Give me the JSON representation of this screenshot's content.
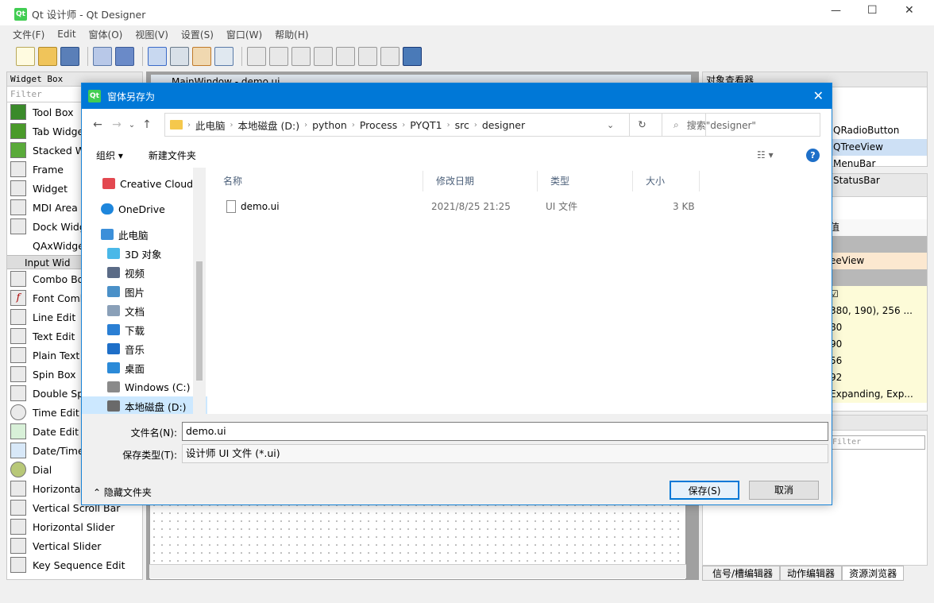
{
  "app": {
    "title": "Qt 设计师 - Qt Designer",
    "logo": "Qt"
  },
  "menu": [
    "文件(F)",
    "Edit",
    "窗体(O)",
    "视图(V)",
    "设置(S)",
    "窗口(W)",
    "帮助(H)"
  ],
  "window_controls": {
    "minimize": "—",
    "maximize": "☐",
    "close": "✕"
  },
  "widget_box": {
    "title": "Widget Box",
    "filter_placeholder": "Filter",
    "items_top": [
      "Tool Box",
      "Tab Widge",
      "Stacked W",
      "Frame",
      "Widget",
      "MDI Area",
      "Dock Widg",
      "QAxWidge"
    ],
    "category": "Input Wid",
    "items_input": [
      "Combo Bo",
      "Font Comb",
      "Line Edit",
      "Text Edit",
      "Plain Text E",
      "Spin Box",
      "Double Sp",
      "Time Edit",
      "Date Edit",
      "Date/Time",
      "Dial",
      "Horizonta...",
      "Vertical Scroll Bar",
      "Horizontal Slider",
      "Vertical Slider",
      "Key Sequence Edit"
    ]
  },
  "mdi": {
    "tab_label": "MainWindow - demo.ui"
  },
  "object_inspector": {
    "title": "对象查看器",
    "rows": [
      "QRadioButton",
      "QTreeView",
      "MenuBar",
      "StatusBar"
    ]
  },
  "property_editor": {
    "header": "值",
    "rows": [
      "",
      "eeView",
      "",
      "☑",
      "380, 190), 256 ...",
      "80",
      "90",
      "56",
      "92",
      "Expanding, Exp..."
    ]
  },
  "resource_panel": {
    "filter_placeholder": "Filter",
    "tabs": [
      "信号/槽编辑器",
      "动作编辑器",
      "资源浏览器"
    ]
  },
  "dialog": {
    "title": "窗体另存为",
    "address": [
      "此电脑",
      "本地磁盘 (D:)",
      "python",
      "Process",
      "PYQT1",
      "src",
      "designer"
    ],
    "search_placeholder": "搜索\"designer\"",
    "organize": "组织 ▾",
    "new_folder": "新建文件夹",
    "nav_items": [
      {
        "label": "Creative Cloud F",
        "color": "#e34850"
      },
      {
        "label": "OneDrive",
        "color": "#1e86dc"
      },
      {
        "label": "此电脑",
        "color": "#3c8fd9"
      },
      {
        "label": "3D 对象",
        "color": "#4ab8e8"
      },
      {
        "label": "视频",
        "color": "#5b6b86"
      },
      {
        "label": "图片",
        "color": "#4a90c8"
      },
      {
        "label": "文档",
        "color": "#8aa0b8"
      },
      {
        "label": "下载",
        "color": "#2a7fd4"
      },
      {
        "label": "音乐",
        "color": "#1e6fc8"
      },
      {
        "label": "桌面",
        "color": "#2b8ad8"
      },
      {
        "label": "Windows (C:)",
        "color": "#8a8a8a"
      },
      {
        "label": "本地磁盘 (D:)",
        "color": "#6a6a6a"
      }
    ],
    "columns": [
      "名称",
      "修改日期",
      "类型",
      "大小"
    ],
    "files": [
      {
        "name": "demo.ui",
        "date": "2021/8/25 21:25",
        "type": "UI 文件",
        "size": "3 KB"
      }
    ],
    "filename_label": "文件名(N):",
    "filename_value": "demo.ui",
    "filetype_label": "保存类型(T):",
    "filetype_value": "设计师 UI 文件 (*.ui)",
    "hide_folders": "隐藏文件夹",
    "save": "保存(S)",
    "cancel": "取消"
  }
}
